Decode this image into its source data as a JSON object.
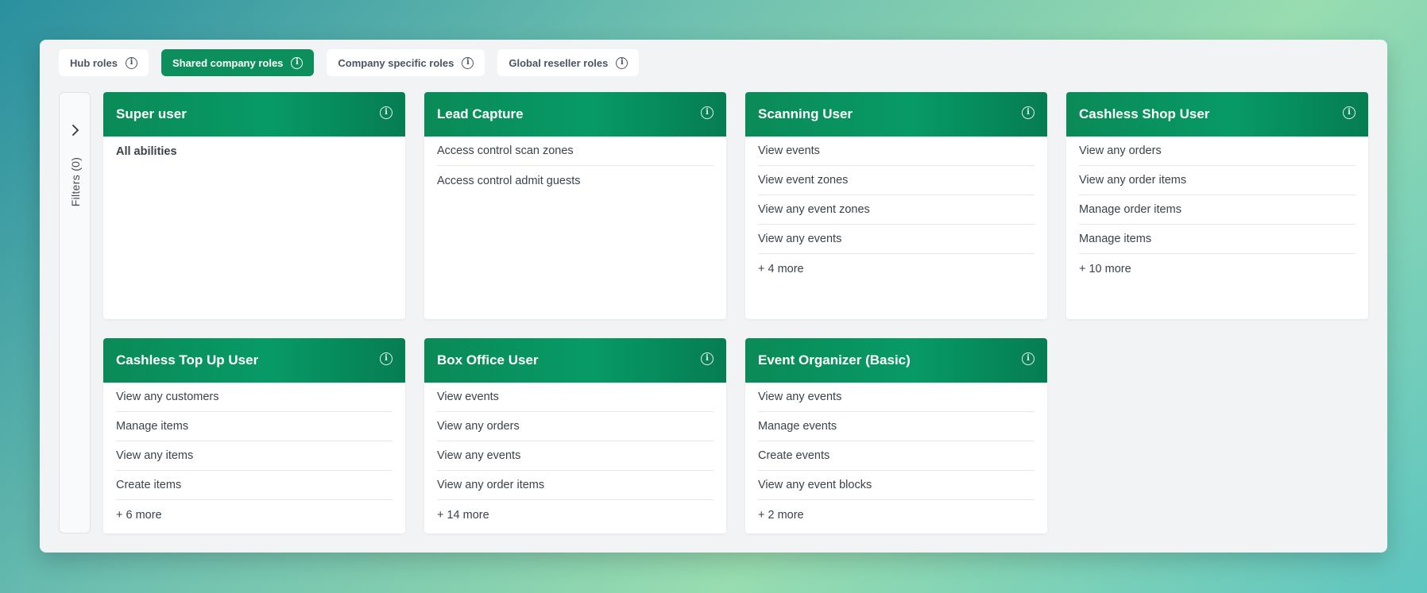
{
  "tabs": [
    {
      "label": "Hub roles",
      "active": false
    },
    {
      "label": "Shared company roles",
      "active": true
    },
    {
      "label": "Company specific roles",
      "active": false
    },
    {
      "label": "Global reseller roles",
      "active": false
    }
  ],
  "filters": {
    "label": "Filters (0)"
  },
  "cards": [
    {
      "title": "Super user",
      "items": [
        "All abilities"
      ]
    },
    {
      "title": "Lead Capture",
      "items": [
        "Access control scan zones",
        "Access control admit guests"
      ]
    },
    {
      "title": "Scanning User",
      "items": [
        "View events",
        "View event zones",
        "View any event zones",
        "View any events",
        "+ 4 more"
      ]
    },
    {
      "title": "Cashless Shop User",
      "items": [
        "View any orders",
        "View any order items",
        "Manage order items",
        "Manage items",
        "+ 10 more"
      ]
    },
    {
      "title": "Cashless Top Up User",
      "items": [
        "View any customers",
        "Manage items",
        "View any items",
        "Create items",
        "+ 6 more"
      ]
    },
    {
      "title": "Box Office User",
      "items": [
        "View events",
        "View any orders",
        "View any events",
        "View any order items",
        "+ 14 more"
      ]
    },
    {
      "title": "Event Organizer (Basic)",
      "items": [
        "View any events",
        "Manage events",
        "Create events",
        "View any event blocks",
        "+ 2 more"
      ]
    }
  ],
  "colors": {
    "accent": "#0c8f5c",
    "panel": "#f2f3f5"
  },
  "icons": {
    "info": "info-icon",
    "expand": "chevron-right-icon"
  }
}
